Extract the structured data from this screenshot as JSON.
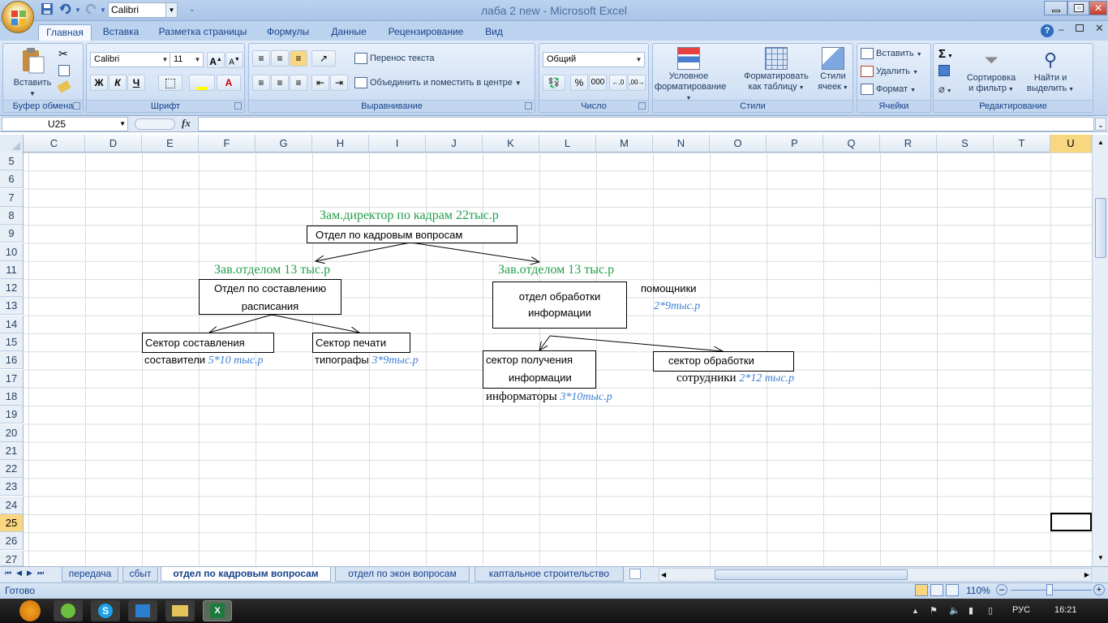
{
  "window": {
    "title": "лаба 2 new  -  Microsoft Excel"
  },
  "qat": {
    "font": "Calibri"
  },
  "tabs": [
    "Главная",
    "Вставка",
    "Разметка страницы",
    "Формулы",
    "Данные",
    "Рецензирование",
    "Вид"
  ],
  "ribbon": {
    "clipboard": {
      "label": "Буфер обмена",
      "paste": "Вставить"
    },
    "font": {
      "label": "Шрифт",
      "name": "Calibri",
      "size": "11",
      "bold": "Ж",
      "italic": "К",
      "underline": "Ч"
    },
    "alignment": {
      "label": "Выравнивание",
      "wrap": "Перенос текста",
      "merge": "Объединить и поместить в центре"
    },
    "number": {
      "label": "Число",
      "format": "Общий",
      "percent": "%",
      "thousands": "000"
    },
    "styles": {
      "label": "Стили",
      "cond1": "Условное",
      "cond2": "форматирование",
      "table1": "Форматировать",
      "table2": "как таблицу",
      "cell1": "Стили",
      "cell2": "ячеек"
    },
    "cells": {
      "label": "Ячейки",
      "insert": "Вставить",
      "delete": "Удалить",
      "format": "Формат"
    },
    "editing": {
      "label": "Редактирование",
      "sort1": "Сортировка",
      "sort2": "и фильтр",
      "find1": "Найти и",
      "find2": "выделить"
    }
  },
  "formula_bar": {
    "name_box": "U25",
    "fx": "fx",
    "value": ""
  },
  "columns": [
    "C",
    "D",
    "E",
    "F",
    "G",
    "H",
    "I",
    "J",
    "K",
    "L",
    "M",
    "N",
    "O",
    "P",
    "Q",
    "R",
    "S",
    "T",
    "U"
  ],
  "rows": [
    "5",
    "6",
    "7",
    "8",
    "9",
    "10",
    "11",
    "12",
    "13",
    "14",
    "15",
    "16",
    "17",
    "18",
    "19",
    "20",
    "21",
    "22",
    "23",
    "24",
    "25",
    "26",
    "27"
  ],
  "selected": {
    "column": "U",
    "row": "25"
  },
  "diagram": {
    "director_title": "Зам.директор по кадрам 22тыс.р",
    "hr_dept": "Отдел по кадровым вопросам",
    "head_left": "Зав.отделом 13 тыс.р",
    "head_right": "Зав.отделом 13 тыс.р",
    "schedule_dept_1": "Отдел по составлению",
    "schedule_dept_2": "расписания",
    "info_dept_1": "отдел обработки",
    "info_dept_2": "информации",
    "helpers": "помощники",
    "helpers_salary": "2*9тыс.р",
    "sector_compose": "Сектор составления",
    "sector_print": "Сектор печати",
    "compilers": "составители",
    "compilers_salary": "5*10 тыс.р",
    "printers": "типографы",
    "printers_salary": "3*9тыс.р",
    "sector_receive_1": "сектор получения",
    "sector_receive_2": "информации",
    "informers": "информаторы",
    "informers_salary": "3*10тыс.р",
    "sector_process": "сектор обработки",
    "staff": "сотрудники",
    "staff_salary": "2*12 тыс.р"
  },
  "sheets": [
    "передача",
    "сбыт",
    "отдел по кадровым вопросам",
    "отдел по экон вопросам",
    "каптальное строительство"
  ],
  "active_sheet": 2,
  "status": {
    "ready": "Готово",
    "zoom": "110%"
  },
  "taskbar": {
    "lang": "РУС",
    "time": "16:21"
  }
}
